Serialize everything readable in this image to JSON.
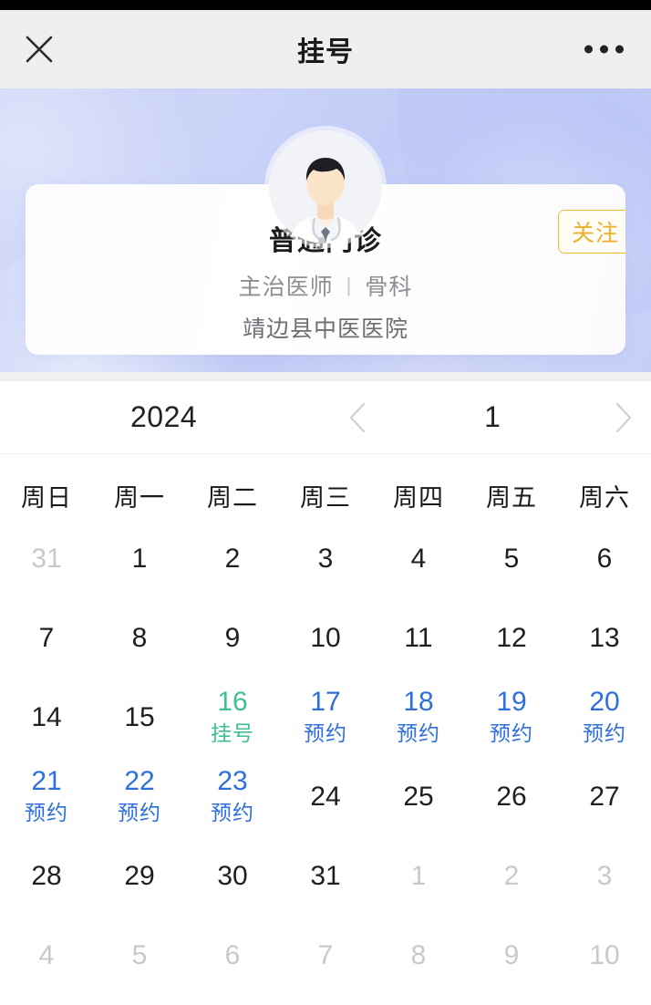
{
  "navbar": {
    "close_icon": "close-icon",
    "title": "挂号",
    "more_icon": "more-dots-icon"
  },
  "doctor_card": {
    "avatar_icon": "doctor-avatar",
    "name": "普通门诊",
    "title_rank": "主治医师",
    "separator": "|",
    "department": "骨科",
    "hospital": "靖边县中医医院",
    "follow_label": "关注",
    "follow_color": "#eab02e"
  },
  "calendar": {
    "year": "2024",
    "month": "1",
    "prev_icon": "chevron-left-icon",
    "next_icon": "chevron-right-icon",
    "weekdays": [
      "周日",
      "周一",
      "周二",
      "周三",
      "周四",
      "周五",
      "周六"
    ],
    "colors": {
      "available": "#2f6fdc",
      "today": "#3ec08f",
      "muted": "#c9c9cd",
      "normal": "#1f1f1f"
    },
    "days": [
      {
        "num": "31",
        "tag": "",
        "state": "muted"
      },
      {
        "num": "1",
        "tag": "",
        "state": "normal"
      },
      {
        "num": "2",
        "tag": "",
        "state": "normal"
      },
      {
        "num": "3",
        "tag": "",
        "state": "normal"
      },
      {
        "num": "4",
        "tag": "",
        "state": "normal"
      },
      {
        "num": "5",
        "tag": "",
        "state": "normal"
      },
      {
        "num": "6",
        "tag": "",
        "state": "normal"
      },
      {
        "num": "7",
        "tag": "",
        "state": "normal"
      },
      {
        "num": "8",
        "tag": "",
        "state": "normal"
      },
      {
        "num": "9",
        "tag": "",
        "state": "normal"
      },
      {
        "num": "10",
        "tag": "",
        "state": "normal"
      },
      {
        "num": "11",
        "tag": "",
        "state": "normal"
      },
      {
        "num": "12",
        "tag": "",
        "state": "normal"
      },
      {
        "num": "13",
        "tag": "",
        "state": "normal"
      },
      {
        "num": "14",
        "tag": "",
        "state": "normal"
      },
      {
        "num": "15",
        "tag": "",
        "state": "normal"
      },
      {
        "num": "16",
        "tag": "挂号",
        "state": "today"
      },
      {
        "num": "17",
        "tag": "预约",
        "state": "avail"
      },
      {
        "num": "18",
        "tag": "预约",
        "state": "avail"
      },
      {
        "num": "19",
        "tag": "预约",
        "state": "avail"
      },
      {
        "num": "20",
        "tag": "预约",
        "state": "avail"
      },
      {
        "num": "21",
        "tag": "预约",
        "state": "avail"
      },
      {
        "num": "22",
        "tag": "预约",
        "state": "avail"
      },
      {
        "num": "23",
        "tag": "预约",
        "state": "avail"
      },
      {
        "num": "24",
        "tag": "",
        "state": "normal"
      },
      {
        "num": "25",
        "tag": "",
        "state": "normal"
      },
      {
        "num": "26",
        "tag": "",
        "state": "normal"
      },
      {
        "num": "27",
        "tag": "",
        "state": "normal"
      },
      {
        "num": "28",
        "tag": "",
        "state": "normal"
      },
      {
        "num": "29",
        "tag": "",
        "state": "normal"
      },
      {
        "num": "30",
        "tag": "",
        "state": "normal"
      },
      {
        "num": "31",
        "tag": "",
        "state": "normal"
      },
      {
        "num": "1",
        "tag": "",
        "state": "muted"
      },
      {
        "num": "2",
        "tag": "",
        "state": "muted"
      },
      {
        "num": "3",
        "tag": "",
        "state": "muted"
      },
      {
        "num": "4",
        "tag": "",
        "state": "muted"
      },
      {
        "num": "5",
        "tag": "",
        "state": "muted"
      },
      {
        "num": "6",
        "tag": "",
        "state": "muted"
      },
      {
        "num": "7",
        "tag": "",
        "state": "muted"
      },
      {
        "num": "8",
        "tag": "",
        "state": "muted"
      },
      {
        "num": "9",
        "tag": "",
        "state": "muted"
      },
      {
        "num": "10",
        "tag": "",
        "state": "muted"
      }
    ]
  }
}
